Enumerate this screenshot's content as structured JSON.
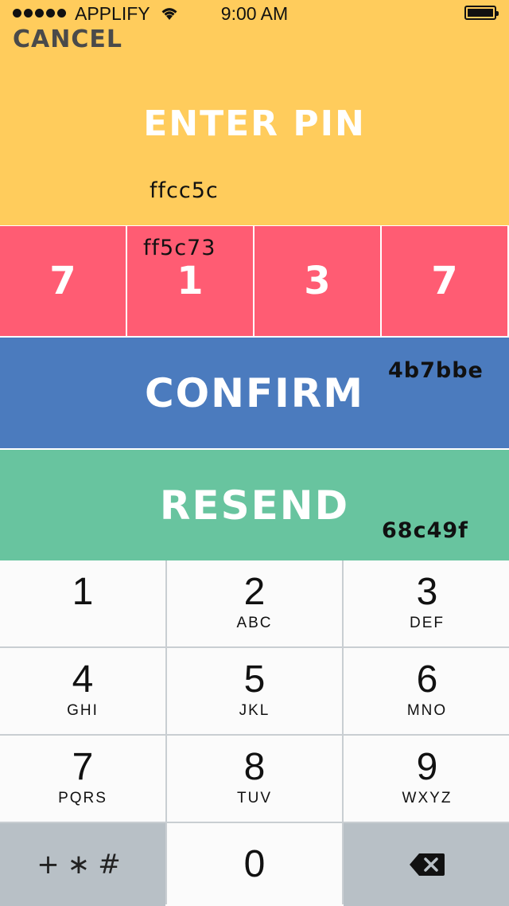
{
  "status_bar": {
    "carrier": "APPLIFY",
    "time": "9:00 AM"
  },
  "header": {
    "cancel_label": "CANCEL",
    "title": "ENTER PIN",
    "color_label": "ffcc5c",
    "color": "#ffcc5c"
  },
  "pin": {
    "digits": [
      "7",
      "1",
      "3",
      "7"
    ],
    "color_label": "ff5c73",
    "color": "#ff5c73"
  },
  "confirm": {
    "label": "CONFIRM",
    "color_label": "4b7bbe",
    "color": "#4b7bbe"
  },
  "resend": {
    "label": "RESEND",
    "color_label": "68c49f",
    "color": "#68c49f"
  },
  "keypad": {
    "keys": [
      {
        "num": "1",
        "letters": ""
      },
      {
        "num": "2",
        "letters": "ABC"
      },
      {
        "num": "3",
        "letters": "DEF"
      },
      {
        "num": "4",
        "letters": "GHI"
      },
      {
        "num": "5",
        "letters": "JKL"
      },
      {
        "num": "6",
        "letters": "MNO"
      },
      {
        "num": "7",
        "letters": "PQRS"
      },
      {
        "num": "8",
        "letters": "TUV"
      },
      {
        "num": "9",
        "letters": "WXYZ"
      }
    ],
    "symbols": "+∗#",
    "zero": "0",
    "delete_icon": "backspace-icon"
  }
}
